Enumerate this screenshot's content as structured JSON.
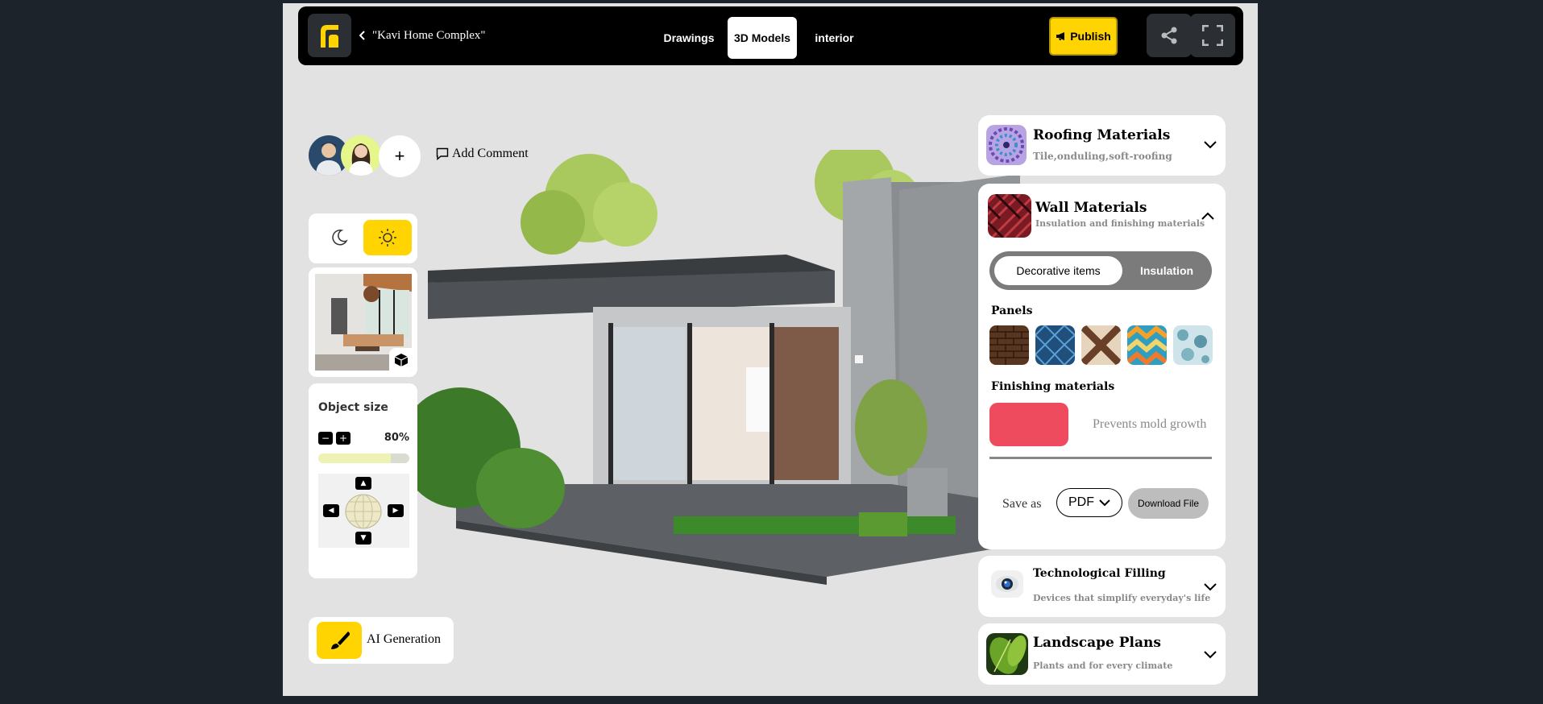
{
  "header": {
    "project_title": "\"Kavi Home Complex\"",
    "tabs": [
      {
        "label": "Drawings",
        "active": false
      },
      {
        "label": "3D Models",
        "active": true
      },
      {
        "label": "interior",
        "active": false
      }
    ],
    "publish_label": "Publish"
  },
  "toolbar": {
    "add_comment_label": "Add Comment"
  },
  "object_size": {
    "title": "Object size",
    "percent_label": "80%",
    "level": 0.8
  },
  "ai": {
    "label": "AI Generation"
  },
  "panels": {
    "roofing": {
      "title": "Roofing Materials",
      "subtitle": "Tile,onduling,soft-roofing"
    },
    "wall": {
      "title": "Wall Materials",
      "subtitle": "Insulation and finishing materials",
      "toggle": {
        "active": "Decorative items",
        "inactive": "Insulation"
      },
      "panels_label": "Panels",
      "finishing_label": "Finishing materials",
      "finishing_text": "Prevents mold growth",
      "finishing_color": "#ee4b5f",
      "save_as_label": "Save as",
      "format_value": "PDF",
      "download_label": "Download File"
    },
    "tech": {
      "title": "Technological Filling",
      "subtitle": "Devices that simplify everyday's life"
    },
    "landscape": {
      "title": "Landscape Plans",
      "subtitle": "Plants and for every climate"
    }
  },
  "colors": {
    "accent": "#ffd400",
    "topbar": "#000000",
    "page_bg": "#1c232b",
    "canvas_bg": "#e2e2e2"
  }
}
